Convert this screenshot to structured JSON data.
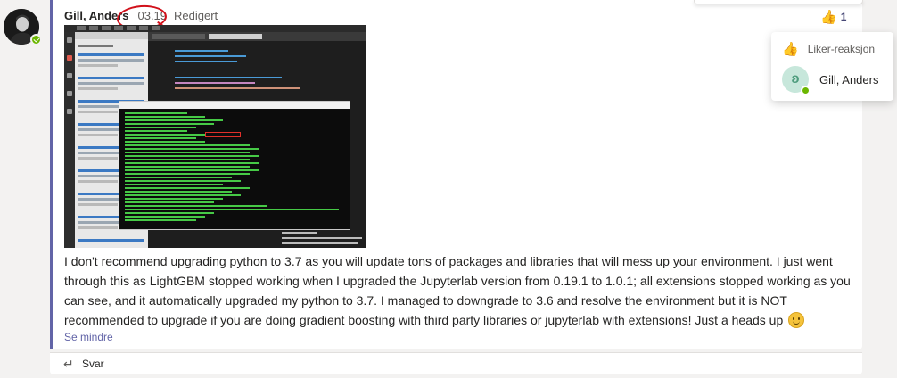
{
  "message": {
    "author": "Gill, Anders",
    "time": "03.19",
    "edited_label": "Redigert",
    "body": "I don't recommend upgrading python to 3.7 as you will update tons of packages and libraries that will mess up your environment. I just went through this as LightGBM stopped working when I upgraded the Jupyterlab version from 0.19.1 to 1.0.1; all extensions stopped working as you can see, and it automatically upgraded my python to 3.7. I managed to downgrade to 3.6 and resolve the environment but it is NOT recommended to upgrade if you are doing gradient boosting with third party libraries or jupyterlab with extensions! Just a heads up",
    "see_less_label": "Se mindre",
    "reaction": {
      "icon": "thumbs-up-icon",
      "count": "1"
    },
    "attachment": {
      "type": "screenshot"
    }
  },
  "reaction_popup": {
    "title": "Liker-reaksjon",
    "users": [
      "Gill, Anders"
    ]
  },
  "reply": {
    "label": "Svar",
    "icon": "reply-arrow-icon"
  },
  "colors": {
    "accent": "#6264a7",
    "annotation": "#d1101a",
    "status": "#6bb700",
    "reaction": "#f4b400"
  }
}
